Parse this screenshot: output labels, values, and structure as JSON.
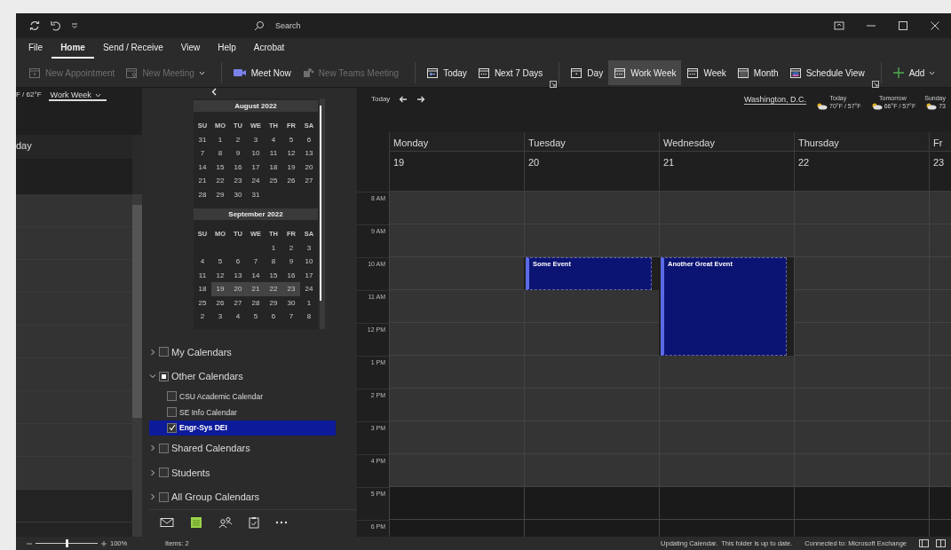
{
  "title_bar": {
    "search": {
      "placeholder": "Search"
    }
  },
  "menu": [
    {
      "label": "File",
      "selected": false
    },
    {
      "label": "Home",
      "selected": true
    },
    {
      "label": "Send / Receive",
      "selected": false
    },
    {
      "label": "View",
      "selected": false
    },
    {
      "label": "Help",
      "selected": false
    },
    {
      "label": "Acrobat",
      "selected": false
    }
  ],
  "ribbon": [
    {
      "buttons": [
        {
          "label": "New Appointment",
          "kind": "calendar",
          "disabled": true,
          "selected": false
        },
        {
          "label": "New Meeting",
          "kind": "meeting",
          "disabled": true,
          "selected": false,
          "dropdown": true
        }
      ]
    },
    {
      "buttons": [
        {
          "label": "Meet Now",
          "kind": "video",
          "disabled": false,
          "selected": false
        },
        {
          "label": "New Teams Meeting",
          "kind": "teams",
          "disabled": true,
          "selected": false
        }
      ]
    },
    {
      "launcher": true,
      "buttons": [
        {
          "label": "Today",
          "kind": "today",
          "disabled": false,
          "selected": false
        },
        {
          "label": "Next 7 Days",
          "kind": "week",
          "disabled": false,
          "selected": false
        }
      ]
    },
    {
      "launcher": true,
      "buttons": [
        {
          "label": "Day",
          "kind": "day",
          "disabled": false,
          "selected": false
        },
        {
          "label": "Work Week",
          "kind": "week",
          "disabled": false,
          "selected": true
        },
        {
          "label": "Week",
          "kind": "week",
          "disabled": false,
          "selected": false
        },
        {
          "label": "Month",
          "kind": "month",
          "disabled": false,
          "selected": false
        },
        {
          "label": "Schedule View",
          "kind": "schedule",
          "disabled": false,
          "selected": false
        }
      ]
    },
    {
      "buttons": [
        {
          "label": "Add",
          "kind": "plus",
          "disabled": false,
          "selected": false,
          "dropdown": true
        }
      ]
    }
  ],
  "ghost_pane": {
    "temp": "F / 62°F",
    "view_select": "Work Week",
    "day_header": "day"
  },
  "mini_calendars": [
    {
      "title": "August 2022",
      "weekdays": [
        "SU",
        "MO",
        "TU",
        "WE",
        "TH",
        "FR",
        "SA"
      ],
      "weeks": [
        [
          {
            "d": "31",
            "selected": false
          },
          {
            "d": "1",
            "selected": false
          },
          {
            "d": "2",
            "selected": false
          },
          {
            "d": "3",
            "selected": false
          },
          {
            "d": "4",
            "selected": false
          },
          {
            "d": "5",
            "selected": false
          },
          {
            "d": "6",
            "selected": false
          }
        ],
        [
          {
            "d": "7",
            "selected": false
          },
          {
            "d": "8",
            "selected": false
          },
          {
            "d": "9",
            "selected": false
          },
          {
            "d": "10",
            "selected": false
          },
          {
            "d": "11",
            "selected": false
          },
          {
            "d": "12",
            "selected": false
          },
          {
            "d": "13",
            "selected": false
          }
        ],
        [
          {
            "d": "14",
            "selected": false
          },
          {
            "d": "15",
            "selected": false
          },
          {
            "d": "16",
            "selected": false
          },
          {
            "d": "17",
            "selected": false
          },
          {
            "d": "18",
            "selected": false
          },
          {
            "d": "19",
            "selected": false
          },
          {
            "d": "20",
            "selected": false
          }
        ],
        [
          {
            "d": "21",
            "selected": false
          },
          {
            "d": "22",
            "selected": false
          },
          {
            "d": "23",
            "selected": false
          },
          {
            "d": "24",
            "selected": false
          },
          {
            "d": "25",
            "selected": false
          },
          {
            "d": "26",
            "selected": false
          },
          {
            "d": "27",
            "selected": false
          }
        ],
        [
          {
            "d": "28",
            "selected": false
          },
          {
            "d": "29",
            "selected": false
          },
          {
            "d": "30",
            "selected": false
          },
          {
            "d": "31",
            "selected": false
          }
        ]
      ]
    },
    {
      "title": "September 2022",
      "weekdays": [
        "SU",
        "MO",
        "TU",
        "WE",
        "TH",
        "FR",
        "SA"
      ],
      "weeks": [
        [
          {
            "d": "1",
            "selected": false
          },
          {
            "d": "2",
            "selected": false
          },
          {
            "d": "3",
            "selected": false
          }
        ],
        [
          {
            "d": "4",
            "selected": false
          },
          {
            "d": "5",
            "selected": false
          },
          {
            "d": "6",
            "selected": false
          },
          {
            "d": "7",
            "selected": false
          },
          {
            "d": "8",
            "selected": false
          },
          {
            "d": "9",
            "selected": false
          },
          {
            "d": "10",
            "selected": false
          }
        ],
        [
          {
            "d": "11",
            "selected": false
          },
          {
            "d": "12",
            "selected": false
          },
          {
            "d": "13",
            "selected": false
          },
          {
            "d": "14",
            "selected": false
          },
          {
            "d": "15",
            "selected": false
          },
          {
            "d": "16",
            "selected": false
          },
          {
            "d": "17",
            "selected": false
          }
        ],
        [
          {
            "d": "18",
            "selected": false
          },
          {
            "d": "19",
            "selected": true
          },
          {
            "d": "20",
            "selected": true
          },
          {
            "d": "21",
            "selected": true
          },
          {
            "d": "22",
            "selected": true
          },
          {
            "d": "23",
            "selected": true
          },
          {
            "d": "24",
            "selected": false
          }
        ],
        [
          {
            "d": "25",
            "selected": false
          },
          {
            "d": "26",
            "selected": false
          },
          {
            "d": "27",
            "selected": false
          },
          {
            "d": "28",
            "selected": false
          },
          {
            "d": "29",
            "selected": false
          },
          {
            "d": "30",
            "selected": false
          },
          {
            "d": "1",
            "selected": false
          }
        ],
        [
          {
            "d": "2",
            "selected": false
          },
          {
            "d": "3",
            "selected": false
          },
          {
            "d": "4",
            "selected": false
          },
          {
            "d": "5",
            "selected": false
          },
          {
            "d": "6",
            "selected": false
          },
          {
            "d": "7",
            "selected": false
          },
          {
            "d": "8",
            "selected": false
          }
        ]
      ]
    }
  ],
  "folders": [
    {
      "label": "My Calendars",
      "expanded": false,
      "checked": false,
      "selected": false
    },
    {
      "label": "Other Calendars",
      "expanded": true,
      "checked": true,
      "mixed": true,
      "selected": false,
      "children": [
        {
          "label": "CSU Academic Calendar",
          "checked": false,
          "selected": false
        },
        {
          "label": "SE Info Calendar",
          "checked": false,
          "selected": false
        },
        {
          "label": "Engr-Sys DEI",
          "checked": true,
          "selected": true
        }
      ]
    },
    {
      "label": "Shared Calendars",
      "expanded": false,
      "checked": false,
      "selected": false
    },
    {
      "label": "Students",
      "expanded": false,
      "checked": false,
      "selected": false
    },
    {
      "label": "All Group Calendars",
      "expanded": false,
      "checked": false,
      "selected": false
    }
  ],
  "nav": [
    {
      "kind": "mail",
      "selected": false
    },
    {
      "kind": "calendar",
      "selected": true
    },
    {
      "kind": "people",
      "selected": false
    },
    {
      "kind": "tasks",
      "selected": false
    },
    {
      "kind": "more",
      "selected": false
    }
  ],
  "calendar_header": {
    "today": "Today",
    "location": "Washington, D.C.",
    "forecasts": [
      {
        "day": "Today",
        "temp": "70°F / 57°F"
      },
      {
        "day": "Tomorrow",
        "temp": "66°F / 57°F"
      },
      {
        "day": "Sunday",
        "temp": "73"
      }
    ]
  },
  "calendar": {
    "hours": [
      {
        "label": "8 AM",
        "work": true
      },
      {
        "label": "9 AM",
        "work": true
      },
      {
        "label": "10 AM",
        "work": true
      },
      {
        "label": "11 AM",
        "work": true
      },
      {
        "label": "12 PM",
        "work": true
      },
      {
        "label": "1 PM",
        "work": true
      },
      {
        "label": "2 PM",
        "work": true
      },
      {
        "label": "3 PM",
        "work": true
      },
      {
        "label": "4 PM",
        "work": true
      },
      {
        "label": "5 PM",
        "work": false
      },
      {
        "label": "6 PM",
        "work": false
      }
    ],
    "days": [
      {
        "name": "Monday",
        "date": "19"
      },
      {
        "name": "Tuesday",
        "date": "20",
        "slots": [
          {
            "kind": "free"
          },
          {
            "kind": "free"
          },
          {
            "kind": "event",
            "title": "Some Event"
          }
        ]
      },
      {
        "name": "Wednesday",
        "date": "21",
        "slots": [
          {
            "kind": "free"
          },
          {
            "kind": "free"
          },
          {
            "kind": "event",
            "title": "Another Great Event"
          },
          {
            "kind": "continued"
          },
          {
            "kind": "continued"
          }
        ]
      },
      {
        "name": "Thursday",
        "date": "22"
      },
      {
        "name": "Fr",
        "date": "23"
      }
    ]
  },
  "status_bar": {
    "zoom": {
      "level": 0.5,
      "label": "100%"
    },
    "items": "Items: 2",
    "message": "Updating Calendar.  This folder is up to date.",
    "connection": "Connected to: Microsoft Exchange"
  }
}
